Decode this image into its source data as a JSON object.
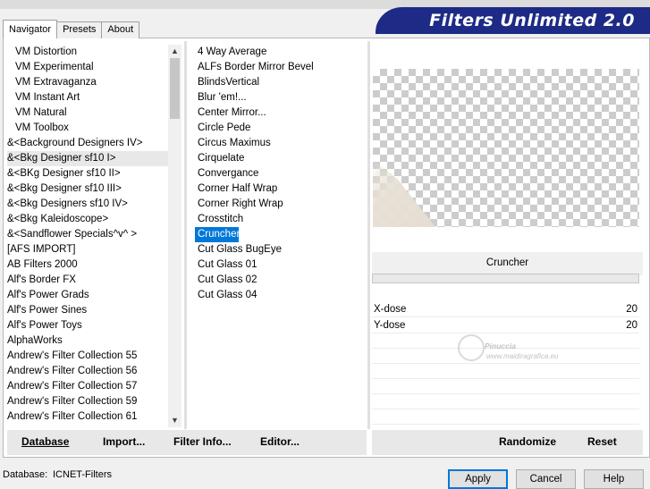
{
  "banner": {
    "title": "Filters Unlimited 2.0"
  },
  "tabs": [
    {
      "label": "Navigator"
    },
    {
      "label": "Presets"
    },
    {
      "label": "About"
    }
  ],
  "categories": [
    {
      "label": "VM Distortion"
    },
    {
      "label": "VM Experimental"
    },
    {
      "label": "VM Extravaganza"
    },
    {
      "label": "VM Instant Art"
    },
    {
      "label": "VM Natural"
    },
    {
      "label": "VM Toolbox"
    },
    {
      "label": "&<Background Designers IV>"
    },
    {
      "label": "&<Bkg Designer sf10 I>"
    },
    {
      "label": "&<BKg Designer sf10 II>"
    },
    {
      "label": "&<Bkg Designer sf10 III>"
    },
    {
      "label": "&<Bkg Designers sf10 IV>"
    },
    {
      "label": "&<Bkg Kaleidoscope>"
    },
    {
      "label": "&<Sandflower Specials^v^ >"
    },
    {
      "label": "[AFS IMPORT]"
    },
    {
      "label": "AB Filters 2000"
    },
    {
      "label": "Alf's Border FX"
    },
    {
      "label": "Alf's Power Grads"
    },
    {
      "label": "Alf's Power Sines"
    },
    {
      "label": "Alf's Power Toys"
    },
    {
      "label": "AlphaWorks"
    },
    {
      "label": "Andrew's Filter Collection 55"
    },
    {
      "label": "Andrew's Filter Collection 56"
    },
    {
      "label": "Andrew's Filter Collection 57"
    },
    {
      "label": "Andrew's Filter Collection 59"
    },
    {
      "label": "Andrew's Filter Collection 61"
    }
  ],
  "filters": [
    {
      "label": "4 Way Average"
    },
    {
      "label": "ALFs Border Mirror Bevel"
    },
    {
      "label": "BlindsVertical"
    },
    {
      "label": "Blur 'em!..."
    },
    {
      "label": "Center Mirror..."
    },
    {
      "label": "Circle Pede"
    },
    {
      "label": "Circus Maximus"
    },
    {
      "label": "Cirquelate"
    },
    {
      "label": "Convergance"
    },
    {
      "label": "Corner Half Wrap"
    },
    {
      "label": "Corner Right Wrap"
    },
    {
      "label": "Crosstitch"
    },
    {
      "label": "Cruncher"
    },
    {
      "label": "Cut Glass  BugEye"
    },
    {
      "label": "Cut Glass 01"
    },
    {
      "label": "Cut Glass 02"
    },
    {
      "label": "Cut Glass 04"
    }
  ],
  "selected_filter": "Cruncher",
  "params": [
    {
      "name": "X-dose",
      "value": "20"
    },
    {
      "name": "Y-dose",
      "value": "20"
    }
  ],
  "watermark": {
    "line1": "Pinuccia",
    "line2": "www.maidiragrafica.eu"
  },
  "left_buttons": {
    "database": "Database",
    "import": "Import...",
    "filter_info": "Filter Info...",
    "editor": "Editor..."
  },
  "right_buttons": {
    "randomize": "Randomize",
    "reset": "Reset"
  },
  "status": {
    "database_label": "Database:",
    "database_value": "ICNET-Filters"
  },
  "dialog_buttons": {
    "apply": "Apply",
    "cancel": "Cancel",
    "help": "Help"
  }
}
